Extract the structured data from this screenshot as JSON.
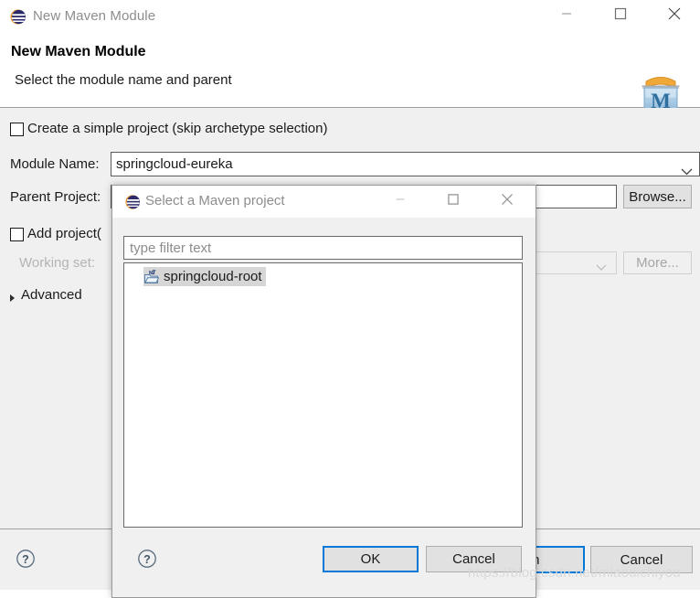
{
  "window": {
    "title": "New Maven Module",
    "icon": "eclipse-globe-icon",
    "controls": {
      "minimize": "minimize-icon",
      "maximize": "maximize-icon",
      "close": "close-icon"
    }
  },
  "wizard": {
    "header": {
      "title": "New Maven Module",
      "subtitle": "Select the module name and parent",
      "banner_icon": "maven-folder-icon",
      "banner_letter": "M"
    },
    "simple_project": {
      "label": "Create a simple project (skip archetype selection)",
      "checked": false
    },
    "module_name": {
      "label": "Module Name:",
      "value": "springcloud-eureka",
      "placeholder": ""
    },
    "parent_project": {
      "label": "Parent Project:",
      "value": "",
      "placeholder": "",
      "browse_label": "Browse..."
    },
    "add_project": {
      "label": "Add project(",
      "checked": false
    },
    "working_set": {
      "label": "Working set:",
      "value": "",
      "more_label": "More...",
      "disabled": true
    },
    "advanced": {
      "label": "Advanced",
      "expanded": false
    },
    "footer": {
      "help_icon": "help-question-icon",
      "back_label": "",
      "next_label": "",
      "finish_label": "nish",
      "cancel_label": "Cancel"
    }
  },
  "dialog": {
    "title": "Select a Maven project",
    "icon": "eclipse-globe-icon",
    "controls": {
      "minimize": "minimize-icon",
      "maximize": "maximize-icon",
      "close": "close-icon"
    },
    "filter": {
      "placeholder": "type filter text",
      "value": ""
    },
    "tree": {
      "items": [
        {
          "label": "springcloud-root",
          "icon": "maven-project-icon",
          "selected": true
        }
      ]
    },
    "buttons": {
      "ok_label": "OK",
      "cancel_label": "Cancel",
      "help_icon": "help-question-icon"
    }
  },
  "watermark": {
    "text": "https://blog.csdn.net/miaodichiyou"
  },
  "colors": {
    "focus_blue": "#0078d7",
    "window_gray": "#f0f0f0",
    "selection_gray": "#d6d6d6",
    "disabled_gray": "#b4b4b4"
  }
}
